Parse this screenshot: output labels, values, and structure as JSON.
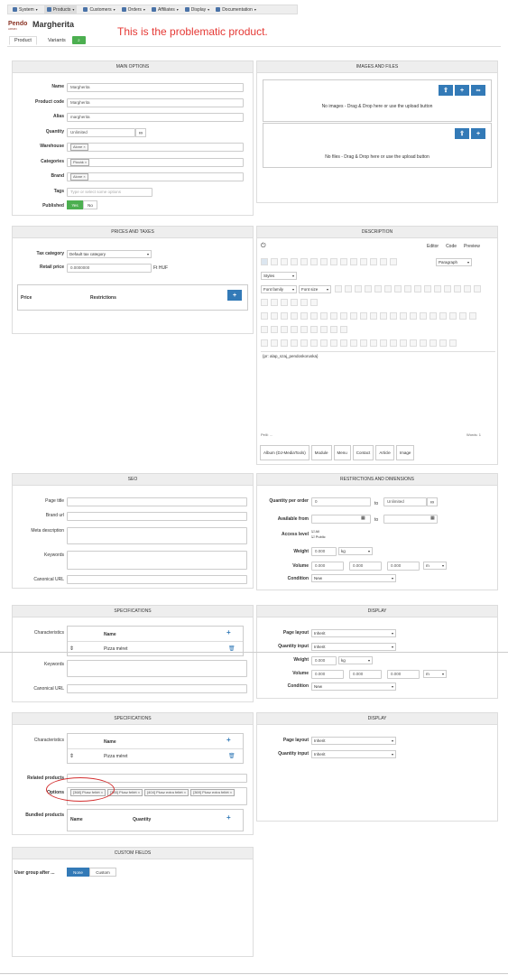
{
  "nav": [
    {
      "label": "System",
      "icon": "wrench-icon"
    },
    {
      "label": "Products",
      "icon": "products-icon",
      "active": true
    },
    {
      "label": "Customers",
      "icon": "users-icon"
    },
    {
      "label": "Orders",
      "icon": "list-icon"
    },
    {
      "label": "Affiliates",
      "icon": "affiliates-icon"
    },
    {
      "label": "Display",
      "icon": "monitor-icon"
    },
    {
      "label": "Documentation",
      "icon": "help-icon"
    }
  ],
  "header": {
    "logo": "Pendo",
    "logo_sub": "ADMIN",
    "title": "Margherita",
    "annotation": "This is the problematic product."
  },
  "tabs": {
    "product": "Product",
    "variants": "Variants",
    "variants_count": "2"
  },
  "main": {
    "title": "MAIN OPTIONS",
    "name_label": "Name",
    "name": "Margherita",
    "code_label": "Product code",
    "code": "Margherita",
    "alias_label": "Alias",
    "alias": "margherita",
    "qty_label": "Quantity",
    "qty": "Unlimited",
    "warehouse_label": "Warehouse",
    "warehouse": "Alone",
    "categories_label": "Categories",
    "categories": "Pizzák",
    "brand_label": "Brand",
    "brand": "Alone",
    "tags_label": "Tags",
    "tags_ph": "Type or select some options",
    "published_label": "Published",
    "yes": "Yes",
    "no": "No"
  },
  "images": {
    "title": "IMAGES AND FILES",
    "img_drop": "No images - Drag & Drop here or use the upload button",
    "file_drop": "No files - Drag & Drop here or use the upload button"
  },
  "prices": {
    "title": "PRICES AND TAXES",
    "tax_label": "Tax category",
    "tax": "Default tax category",
    "retail_label": "Retail price",
    "retail": "0.0000000",
    "currency": "Ft HUF",
    "col_price": "Price",
    "col_restr": "Restrictions"
  },
  "desc": {
    "title": "DESCRIPTION",
    "tabs": [
      "Editor",
      "Code",
      "Preview"
    ],
    "paragraph": "Paragraph",
    "styles": "Styles",
    "font_family": "Font family",
    "font_size": "Font size",
    "body": "{pr: alap_szaj_pendoskoruska}",
    "path": "Pelli: ...",
    "words": "Words: 1",
    "buttons": [
      "Album (DJ-MediaTools)",
      "Module",
      "Menu",
      "Contact",
      "Article",
      "Image"
    ]
  },
  "seo": {
    "title": "SEO",
    "page_title": "Page title",
    "brand_url": "Brand url",
    "meta": "Meta description",
    "keywords": "Keywords",
    "canonical": "Canonical URL"
  },
  "restr": {
    "title": "RESTRICTIONS AND DIMENSIONS",
    "qpo": "Quantity per order",
    "qpo_val": "0",
    "to": "to",
    "unl": "Unlimited",
    "avail": "Available from",
    "access": "Access level",
    "access_vals": [
      "All",
      "Public"
    ],
    "weight": "Weight",
    "weight_val": "0.000",
    "kg": "kg",
    "volume": "Volume",
    "vol": "0.000",
    "m": "m",
    "cond": "Condition",
    "cond_val": "New"
  },
  "spec1": {
    "title": "SPECIFICATIONS",
    "characteristics": "Characteristics",
    "name": "Name",
    "item": "Pizza méret",
    "keywords": "Keywords",
    "canonical": "Canonical URL"
  },
  "display1": {
    "title": "DISPLAY",
    "page_layout": "Page layout",
    "pl": "Inherit",
    "qi": "Quantity input",
    "qiv": "Inherit",
    "weight": "Weight",
    "wv": "0.000",
    "kg": "kg",
    "volume": "Volume",
    "vv": "0.000",
    "m": "m",
    "cond": "Condition",
    "cv": "New"
  },
  "spec2": {
    "title": "SPECIFICATIONS",
    "characteristics": "Characteristics",
    "name": "Name",
    "item": "Pizza méret",
    "related": "Related products",
    "options": "Options",
    "opts": [
      "[368] Plusz feltét",
      "[385] Plusz feltét",
      "[404] Plusz extra feltét",
      "[369] Plusz extra feltét"
    ],
    "bundled": "Bundled products",
    "bname": "Name",
    "bqty": "Quantity"
  },
  "display2": {
    "title": "DISPLAY",
    "page_layout": "Page layout",
    "pl": "Inherit",
    "qi": "Quantity input",
    "qiv": "Inherit"
  },
  "custom": {
    "title": "CUSTOM FIELDS",
    "ug": "User group after ...",
    "none": "None",
    "custom": "Custom"
  }
}
